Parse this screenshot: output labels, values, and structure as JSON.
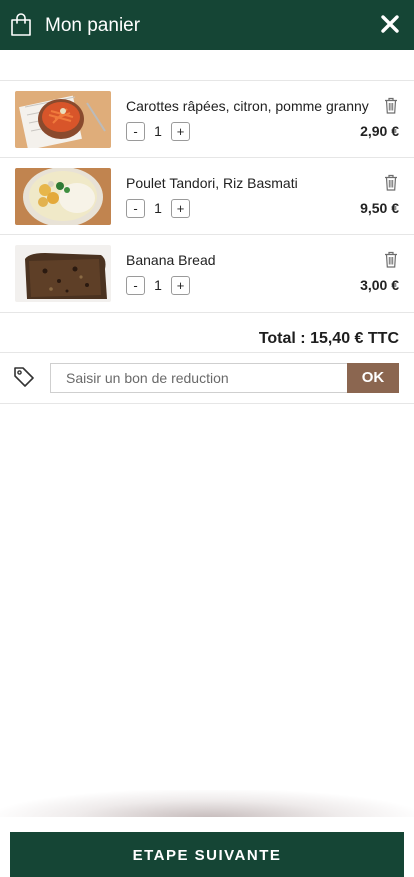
{
  "header": {
    "title": "Mon panier",
    "bag_icon": "shopping-bag-icon",
    "close_icon": "close-icon"
  },
  "cart": {
    "items": [
      {
        "name": "Carottes râpées, citron, pomme granny",
        "quantity": "1",
        "price": "2,90 €",
        "minus_label": "-",
        "plus_label": "+",
        "image": "carrot-salad-bowl"
      },
      {
        "name": "Poulet Tandori, Riz Basmati",
        "quantity": "1",
        "price": "9,50 €",
        "minus_label": "-",
        "plus_label": "+",
        "image": "chicken-rice-bowl"
      },
      {
        "name": "Banana Bread",
        "quantity": "1",
        "price": "3,00 €",
        "minus_label": "-",
        "plus_label": "+",
        "image": "banana-bread-slice"
      }
    ],
    "total": "Total : 15,40 € TTC"
  },
  "coupon": {
    "placeholder": "Saisir un bon de reduction",
    "value": "",
    "ok_label": "OK",
    "icon": "tag-icon"
  },
  "footer": {
    "next_label": "ETAPE SUIVANTE"
  },
  "colors": {
    "primary": "#154535",
    "accent": "#8b6650"
  }
}
